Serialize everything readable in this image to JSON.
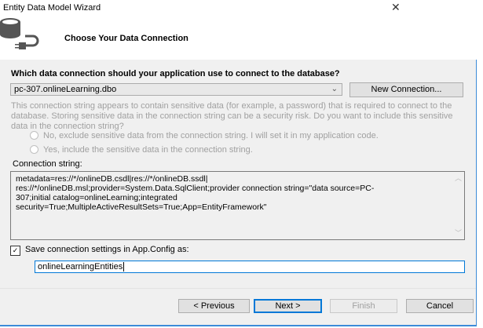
{
  "window": {
    "title": "Entity Data Model Wizard",
    "close": "✕"
  },
  "header": {
    "title": "Choose Your Data Connection"
  },
  "question": "Which data connection should your application use to connect to the database?",
  "connection_select": {
    "value": "pc-307.onlineLearning.dbo"
  },
  "new_connection_label": "New Connection...",
  "sensitive_info": "This connection string appears to contain sensitive data (for example, a password) that is required to connect to the database. Storing sensitive data in the connection string can be a security risk. Do you want to include this sensitive data in the connection string?",
  "radio_no": "No, exclude sensitive data from the connection string. I will set it in my application code.",
  "radio_yes": "Yes, include the sensitive data in the connection string.",
  "connection_string_label": "Connection string:",
  "connection_string": "metadata=res://*/onlineDB.csdl|res://*/onlineDB.ssdl|\nres://*/onlineDB.msl;provider=System.Data.SqlClient;provider connection string=\"data source=PC-\n307;initial catalog=onlineLearning;integrated\nsecurity=True;MultipleActiveResultSets=True;App=EntityFramework\"",
  "save_checkbox": {
    "label": "Save connection settings in App.Config as:",
    "checked": true
  },
  "entity_name": "onlineLearningEntities",
  "buttons": {
    "previous": "< Previous",
    "next": "Next >",
    "finish": "Finish",
    "cancel": "Cancel"
  }
}
